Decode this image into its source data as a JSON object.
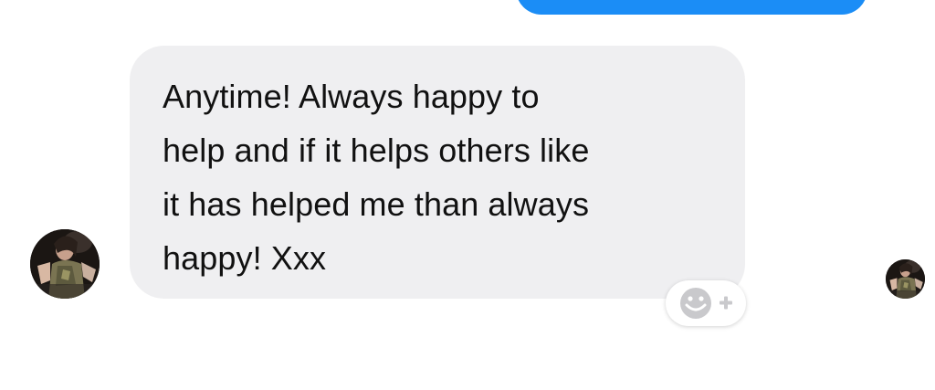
{
  "conversation": {
    "received_message": {
      "text": "Anytime! Always happy to\nhelp and if it helps others like\nit has helped me than always\nhappy! Xxx"
    },
    "reaction_control": {
      "icon": "smiley-plus-icon"
    },
    "avatars": {
      "sender_icon": "avatar-photo",
      "read_receipt_icon": "avatar-photo"
    }
  },
  "colors": {
    "sent_bubble": "#1b8df6",
    "received_bubble": "#efeff1",
    "text": "#111111",
    "reaction_icon": "#c9c9cc"
  }
}
